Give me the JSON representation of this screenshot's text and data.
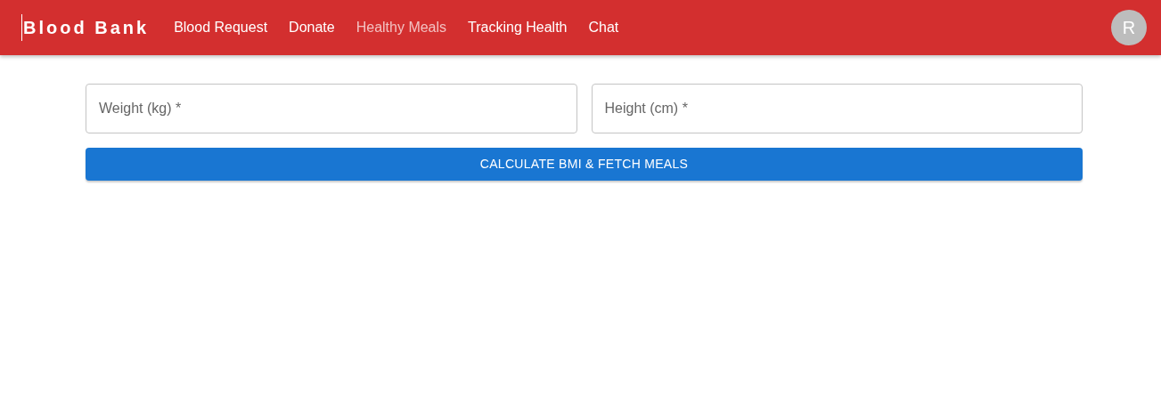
{
  "navbar": {
    "brand": "Blood Bank",
    "links": [
      {
        "label": "Blood Request",
        "selected": false
      },
      {
        "label": "Donate",
        "selected": false
      },
      {
        "label": "Healthy Meals",
        "selected": true
      },
      {
        "label": "Tracking Health",
        "selected": false
      },
      {
        "label": "Chat",
        "selected": false
      }
    ],
    "avatar": "R"
  },
  "form": {
    "fields": [
      {
        "placeholder": "Weight (kg) *"
      },
      {
        "placeholder": "Height (cm) *"
      }
    ],
    "button": "CALCULATE BMI & FETCH MEALS"
  }
}
